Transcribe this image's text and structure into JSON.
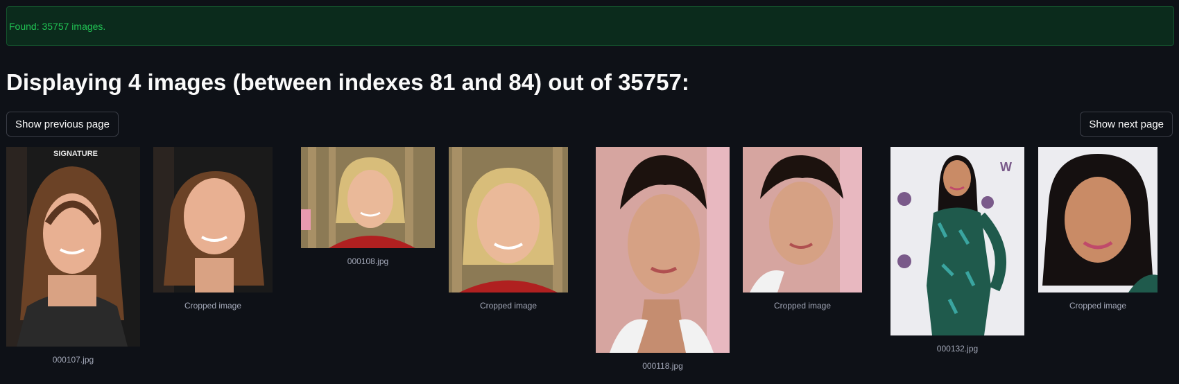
{
  "alert": {
    "text": "Found: 35757 images."
  },
  "heading": "Displaying 4 images (between indexes 81 and 84) out of 35757:",
  "buttons": {
    "prev": "Show previous page",
    "next": "Show next page"
  },
  "images": [
    {
      "original_caption": "000107.jpg",
      "cropped_caption": "Cropped image",
      "sign_text": "SIGNATURE"
    },
    {
      "original_caption": "000108.jpg",
      "cropped_caption": "Cropped image"
    },
    {
      "original_caption": "000118.jpg",
      "cropped_caption": "Cropped image"
    },
    {
      "original_caption": "000132.jpg",
      "cropped_caption": "Cropped image"
    }
  ]
}
